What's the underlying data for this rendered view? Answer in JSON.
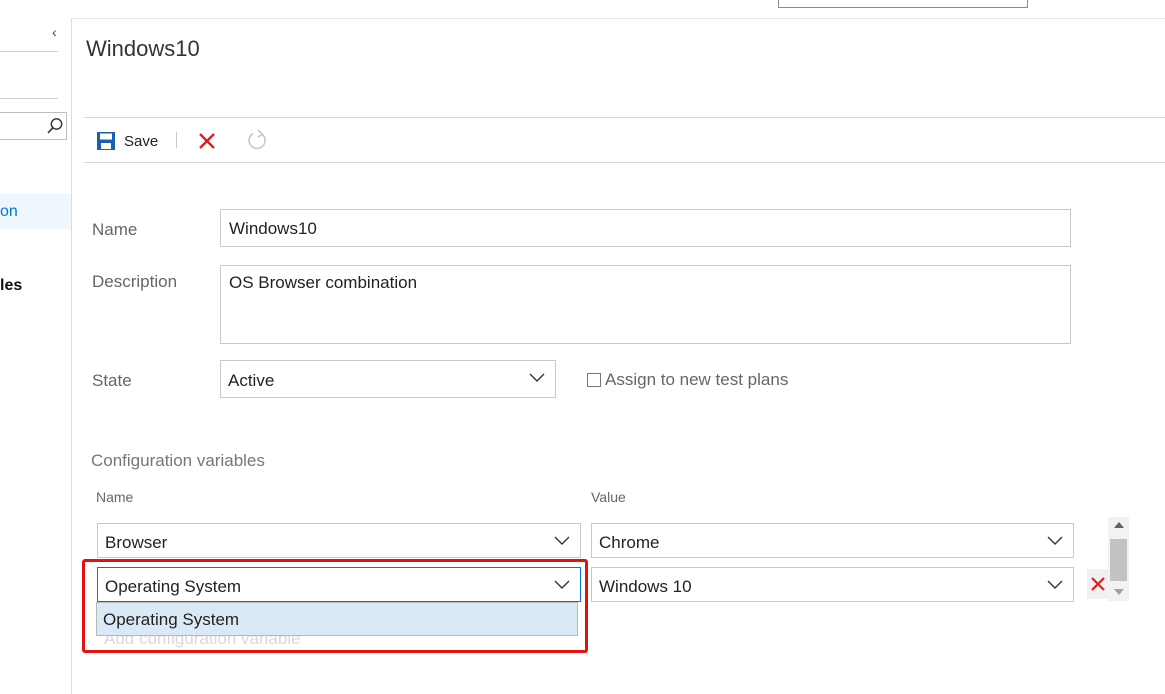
{
  "sidebar": {
    "collapse_icon": "chevron-left-icon",
    "selected_item_fragment": "on",
    "bold_item_fragment": "les",
    "search_icon": "search-icon"
  },
  "page": {
    "title": "Windows10"
  },
  "toolbar": {
    "save_label": "Save",
    "save_icon": "save-icon",
    "discard_icon": "close-icon",
    "refresh_icon": "refresh-icon",
    "accent": "#0078d4",
    "danger": "#d92020"
  },
  "form": {
    "name_label": "Name",
    "name_value": "Windows10",
    "description_label": "Description",
    "description_value": "OS Browser combination",
    "state_label": "State",
    "state_value": "Active",
    "assign_label": "Assign to new test plans",
    "assign_checked": false
  },
  "config": {
    "title": "Configuration variables",
    "name_header": "Name",
    "value_header": "Value",
    "rows": [
      {
        "name": "Browser",
        "value": "Chrome"
      },
      {
        "name": "Operating System",
        "value": "Windows 10"
      }
    ],
    "dropdown_option": "Operating System",
    "add_label": "Add configuration variable"
  }
}
